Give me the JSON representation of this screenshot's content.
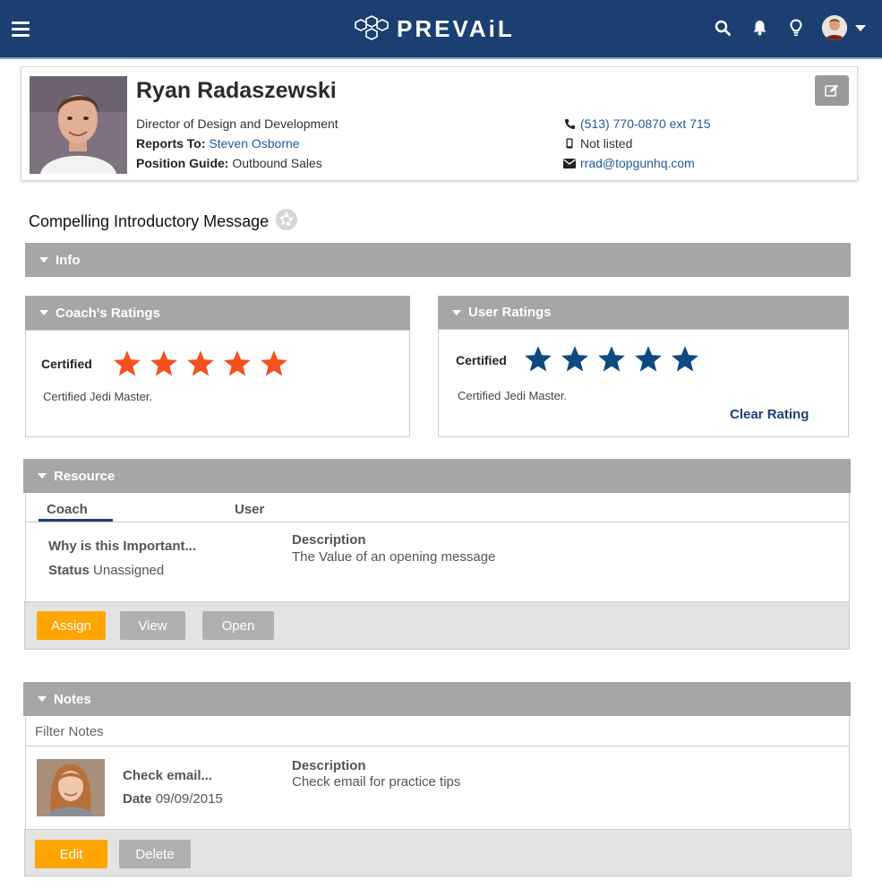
{
  "app": {
    "brand": "PREVAiL"
  },
  "profile": {
    "name": "Ryan Radaszewski",
    "title": "Director of Design and Development",
    "reports_to_label": "Reports To:",
    "reports_to": "Steven Osborne",
    "position_guide_label": "Position Guide:",
    "position_guide": "Outbound Sales",
    "phone": "(513) 770-0870 ext 715",
    "mobile": "Not listed",
    "email": "rrad@topgunhq.com"
  },
  "page_title": "Compelling Introductory Message",
  "info_panel": {
    "label": "Info"
  },
  "coach_ratings": {
    "label": "Coach's Ratings",
    "rating_label": "Certified",
    "stars": 5,
    "note": "Certified Jedi Master.",
    "star_color": "#f4511e"
  },
  "user_ratings": {
    "label": "User Ratings",
    "rating_label": "Certified",
    "stars": 5,
    "note": "Certified Jedi Master.",
    "clear_label": "Clear Rating",
    "star_color": "#0d4a80"
  },
  "resource": {
    "label": "Resource",
    "tabs": [
      "Coach",
      "User"
    ],
    "active_tab": "Coach",
    "item_title": "Why is this Important...",
    "status_label": "Status",
    "status_value": "Unassigned",
    "description_label": "Description",
    "description_value": "The Value of an opening message",
    "buttons": {
      "assign": "Assign",
      "view": "View",
      "open": "Open"
    }
  },
  "notes": {
    "label": "Notes",
    "filter_placeholder": "Filter Notes",
    "item_title": "Check email...",
    "date_label": "Date",
    "date_value": "09/09/2015",
    "description_label": "Description",
    "description_value": "Check email for practice tips",
    "buttons": {
      "edit": "Edit",
      "delete": "Delete"
    }
  },
  "colors": {
    "header_bg": "#1c3f72",
    "panel_header": "#a6a6a6",
    "primary_button": "#ffa500"
  }
}
